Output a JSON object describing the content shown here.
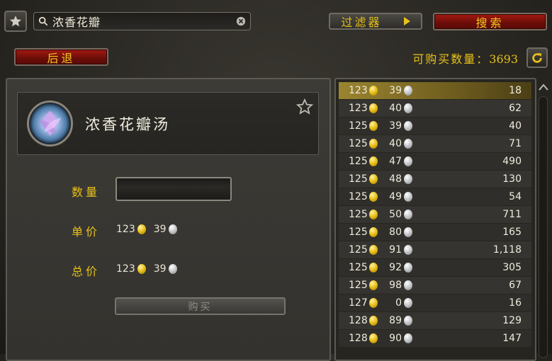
{
  "search": {
    "value": "浓香花瓣"
  },
  "toolbar": {
    "filter_label": "过滤器",
    "search_label": "搜索",
    "back_label": "后退"
  },
  "available": {
    "label": "可购买数量：",
    "count": "3693"
  },
  "item": {
    "name": "浓香花瓣汤"
  },
  "purchase": {
    "quantity_label": "数量",
    "unit_price_label": "单价",
    "unit_gold": "123",
    "unit_silver": "39",
    "total_label": "总价",
    "total_gold": "123",
    "total_silver": "39",
    "buy_label": "购买"
  },
  "listings": [
    {
      "gold": "123",
      "silver": "39",
      "qty": "18"
    },
    {
      "gold": "123",
      "silver": "40",
      "qty": "62"
    },
    {
      "gold": "125",
      "silver": "39",
      "qty": "40"
    },
    {
      "gold": "125",
      "silver": "40",
      "qty": "71"
    },
    {
      "gold": "125",
      "silver": "47",
      "qty": "490"
    },
    {
      "gold": "125",
      "silver": "48",
      "qty": "130"
    },
    {
      "gold": "125",
      "silver": "49",
      "qty": "54"
    },
    {
      "gold": "125",
      "silver": "50",
      "qty": "711"
    },
    {
      "gold": "125",
      "silver": "80",
      "qty": "165"
    },
    {
      "gold": "125",
      "silver": "91",
      "qty": "1,118"
    },
    {
      "gold": "125",
      "silver": "92",
      "qty": "305"
    },
    {
      "gold": "125",
      "silver": "98",
      "qty": "67"
    },
    {
      "gold": "127",
      "silver": "0",
      "qty": "16"
    },
    {
      "gold": "128",
      "silver": "89",
      "qty": "129"
    },
    {
      "gold": "128",
      "silver": "90",
      "qty": "147"
    }
  ],
  "colors": {
    "gold_text": "#e7c21a",
    "red_button": "#a51912",
    "selected_row": "#9a8430"
  }
}
